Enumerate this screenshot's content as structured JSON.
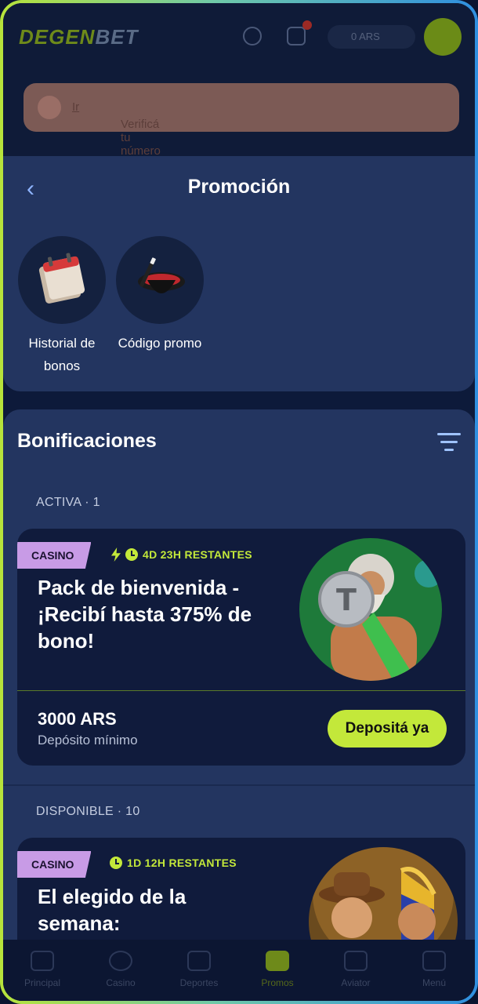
{
  "background_app": {
    "logo_text": "DEGEN",
    "logo_tail": "BET",
    "currency": "0 ARS",
    "verify_text": "Verificá tu número celular",
    "verify_link": "Ir",
    "nav": [
      "Principal",
      "Casino",
      "Deportes",
      "Promos",
      "Aviator",
      "Menú"
    ]
  },
  "sheet": {
    "title": "Promoción",
    "quick_actions": [
      {
        "label": "Historial de bonos",
        "icon": "calendar-icon"
      },
      {
        "label": "Código promo",
        "icon": "magic-hat-icon"
      }
    ]
  },
  "bonuses": {
    "title": "Bonificaciones",
    "active_label": "ACTIVA · 1",
    "available_label": "DISPONIBLE · 10",
    "cards": [
      {
        "tag": "CASINO",
        "timer": "4D 23H RESTANTES",
        "title": "Pack de bienvenida - ¡Recibí hasta 375% de bono!",
        "amount": "3000 ARS",
        "amount_caption": "Depósito mínimo",
        "cta": "Depositá ya"
      },
      {
        "tag": "CASINO",
        "timer": "1D 12H RESTANTES",
        "title": "El elegido de la semana:"
      }
    ]
  },
  "colors": {
    "accent": "#c3e83a",
    "tag": "#c89be6",
    "panel": "#233560",
    "card": "#101b3c"
  }
}
